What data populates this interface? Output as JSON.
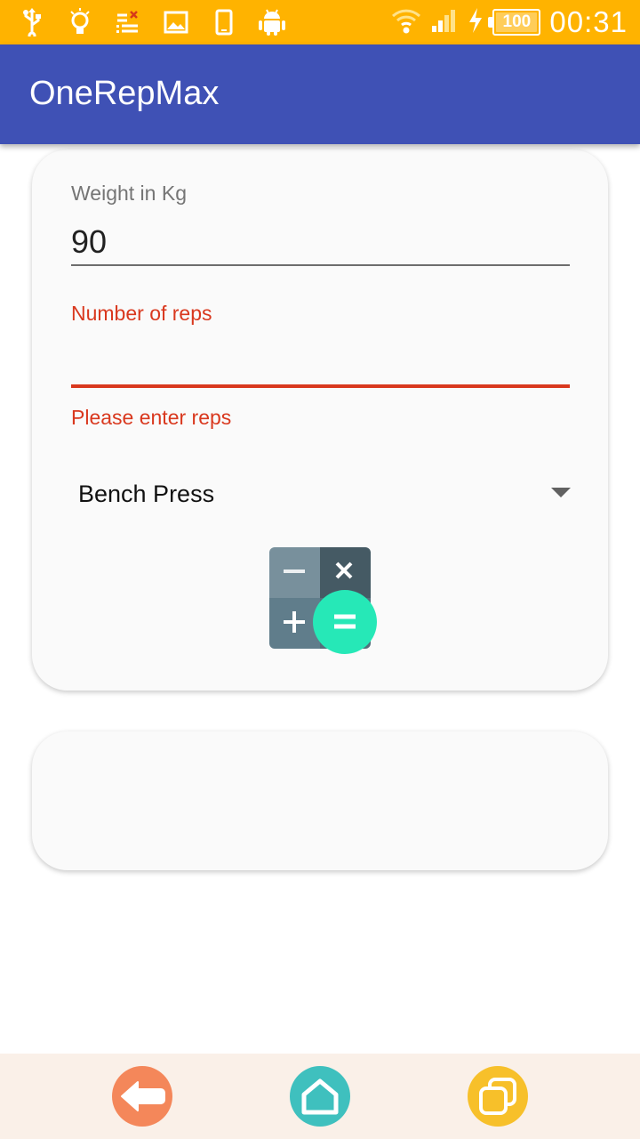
{
  "status_bar": {
    "time": "00:31",
    "battery_level": "100",
    "battery_fraction": 1.0,
    "icons": [
      "usb-icon",
      "bulb-icon",
      "notification-list-icon",
      "image-icon",
      "phone-icon",
      "android-icon",
      "wifi-icon",
      "signal-icon",
      "charging-icon",
      "battery-icon"
    ],
    "color": "#FFB300"
  },
  "app_bar": {
    "title": "OneRepMax",
    "color": "#3F51B5"
  },
  "form": {
    "weight_label": "Weight in Kg",
    "weight_value": "90",
    "reps_label": "Number of reps",
    "reps_value": "",
    "reps_error": "Please enter reps",
    "exercise_selected": "Bench Press",
    "error_color": "#D9381E",
    "calculate_icon": "calculator-icon"
  },
  "nav_bar": {
    "buttons": [
      "back-icon",
      "home-icon",
      "recent-apps-icon"
    ]
  }
}
